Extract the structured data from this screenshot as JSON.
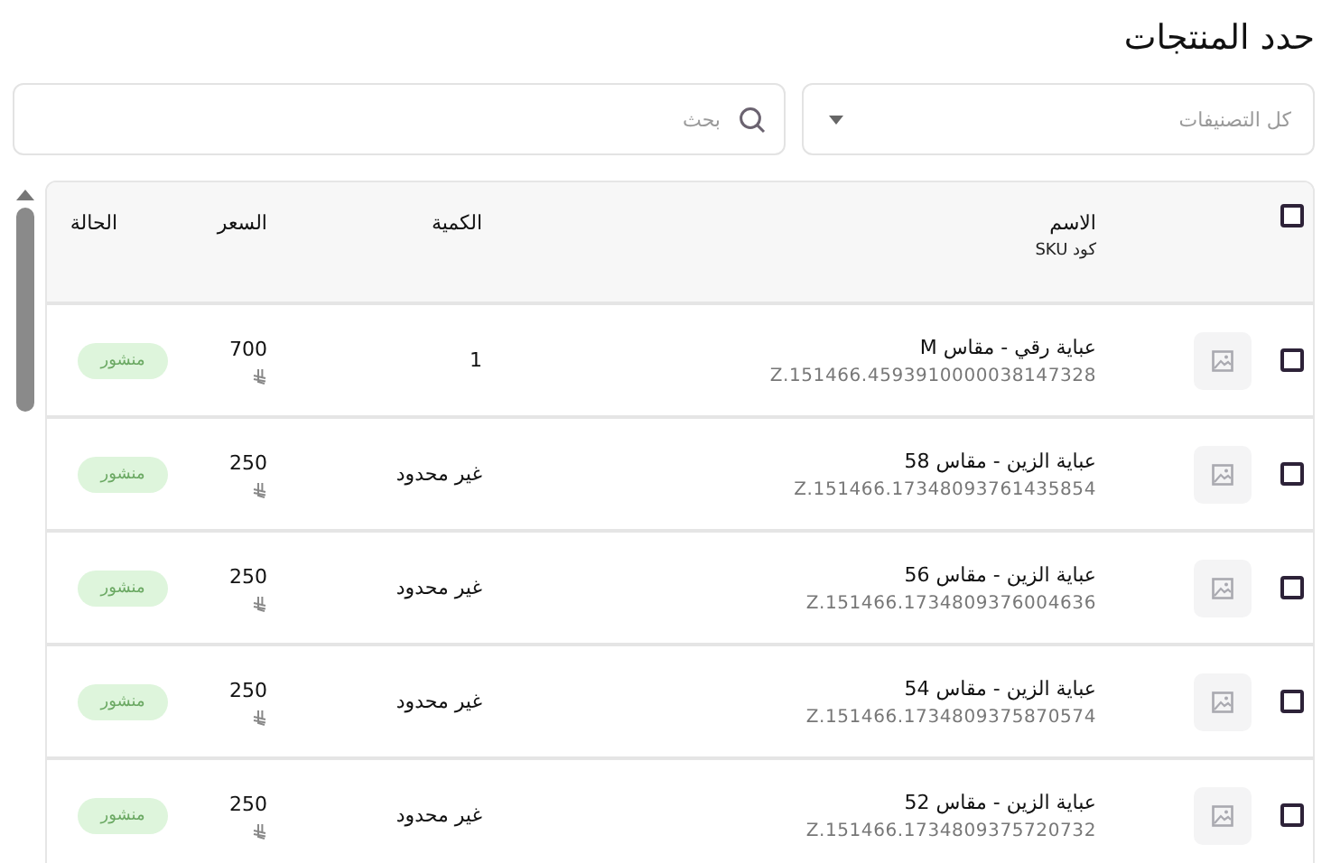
{
  "title": "حدد المنتجات",
  "filters": {
    "category": {
      "placeholder": "كل التصنيفات"
    },
    "search": {
      "placeholder": "بحث"
    }
  },
  "table": {
    "select_all_checked": false,
    "columns": [
      "الاسم",
      "الكمية",
      "السعر",
      "الحالة"
    ],
    "name_subheading": "كود SKU",
    "rows": [
      {
        "checked": false,
        "name": "عباية رقي - مقاس M",
        "sku": "Z.151466.4593910000038147328",
        "quantity": "1",
        "price": "700",
        "status": "منشور"
      },
      {
        "checked": false,
        "name": "عباية الزين - مقاس 58",
        "sku": "Z.151466.17348093761435854",
        "quantity": "غير محدود",
        "price": "250",
        "status": "منشور"
      },
      {
        "checked": false,
        "name": "عباية الزين - مقاس 56",
        "sku": "Z.151466.1734809376004636",
        "quantity": "غير محدود",
        "price": "250",
        "status": "منشور"
      },
      {
        "checked": false,
        "name": "عباية الزين - مقاس 54",
        "sku": "Z.151466.1734809375870574",
        "quantity": "غير محدود",
        "price": "250",
        "status": "منشور"
      },
      {
        "checked": false,
        "name": "عباية الزين - مقاس 52",
        "sku": "Z.151466.1734809375720732",
        "quantity": "غير محدود",
        "price": "250",
        "status": "منشور"
      }
    ]
  }
}
